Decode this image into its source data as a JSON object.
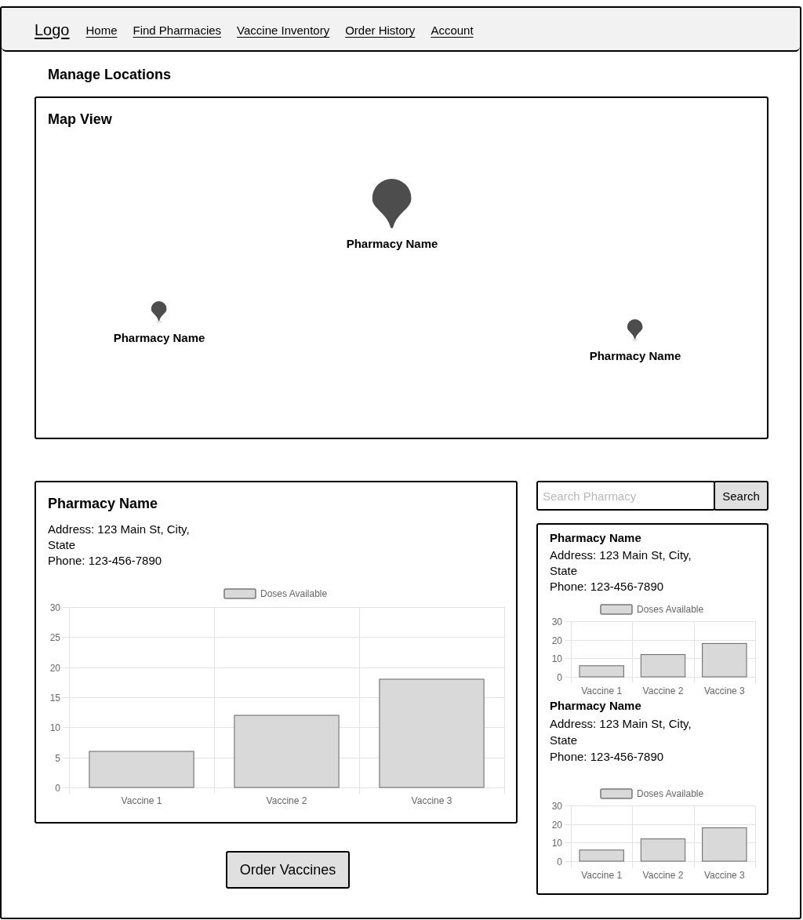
{
  "nav": {
    "logo": "Logo",
    "links": [
      "Home",
      "Find Pharmacies",
      "Vaccine Inventory",
      "Order History",
      "Account"
    ]
  },
  "page_title": "Manage Locations",
  "map": {
    "title": "Map View",
    "markers": [
      {
        "label": "Pharmacy Name",
        "selected": true
      },
      {
        "label": "Pharmacy Name",
        "selected": false
      },
      {
        "label": "Pharmacy Name",
        "selected": false
      }
    ]
  },
  "details": {
    "name": "Pharmacy Name",
    "address": "Address: 123 Main St, City, State",
    "phone": "Phone: 123-456-7890",
    "chart_data": {
      "type": "bar",
      "categories": [
        "Vaccine 1",
        "Vaccine 2",
        "Vaccine 3"
      ],
      "series": [
        {
          "name": "Doses Available",
          "color": "#d9d9d9",
          "values": [
            6,
            12,
            18
          ]
        }
      ],
      "ylim": [
        0,
        30
      ],
      "yticks": [
        0,
        5,
        10,
        15,
        20,
        25,
        30
      ],
      "grid": true
    }
  },
  "search": {
    "placeholder": "Search Pharmacy",
    "button": "Search"
  },
  "results": [
    {
      "name": "Pharmacy Name",
      "address": "Address: 123 Main St, City, State",
      "phone": "Phone: 123-456-7890",
      "chart_data": {
        "type": "bar",
        "categories": [
          "Vaccine 1",
          "Vaccine 2",
          "Vaccine 3"
        ],
        "series": [
          {
            "name": "Doses Available",
            "color": "#d9d9d9",
            "values": [
              6,
              12,
              18
            ]
          }
        ],
        "ylim": [
          0,
          30
        ],
        "yticks": [
          0,
          10,
          20,
          30
        ],
        "grid": true
      }
    },
    {
      "name": "Pharmacy Name",
      "address": "Address: 123 Main St, City, State",
      "phone": "Phone: 123-456-7890",
      "chart_data": {
        "type": "bar",
        "categories": [
          "Vaccine 1",
          "Vaccine 2",
          "Vaccine 3"
        ],
        "series": [
          {
            "name": "Doses Available",
            "color": "#d9d9d9",
            "values": [
              6,
              12,
              18
            ]
          }
        ],
        "ylim": [
          0,
          30
        ],
        "yticks": [
          0,
          10,
          20,
          30
        ],
        "grid": true
      }
    }
  ],
  "order_button": "Order Vaccines"
}
